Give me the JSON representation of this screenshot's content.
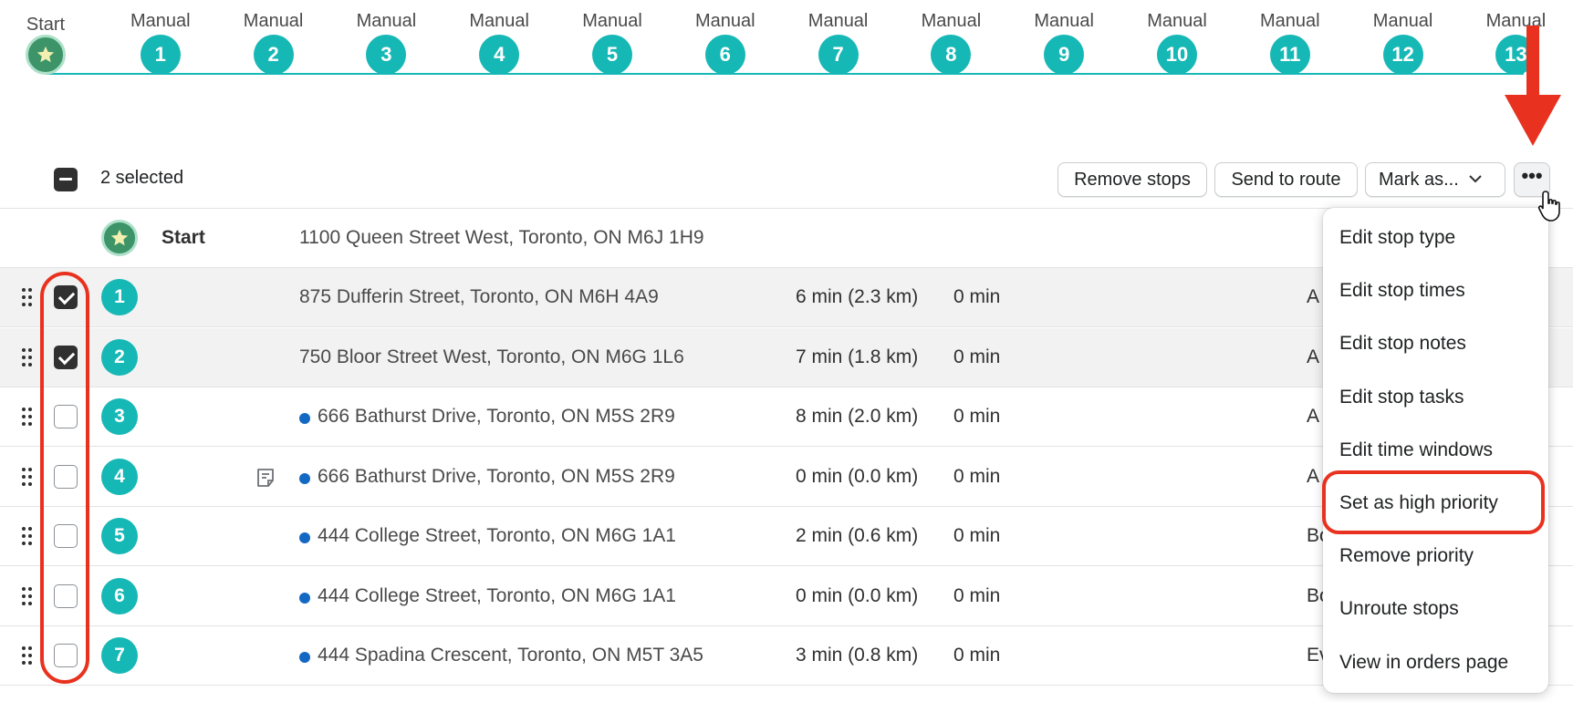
{
  "timeline": {
    "steps": [
      {
        "label": "Start",
        "badge": ""
      },
      {
        "label": "Manual",
        "badge": "1"
      },
      {
        "label": "Manual",
        "badge": "2"
      },
      {
        "label": "Manual",
        "badge": "3"
      },
      {
        "label": "Manual",
        "badge": "4"
      },
      {
        "label": "Manual",
        "badge": "5"
      },
      {
        "label": "Manual",
        "badge": "6"
      },
      {
        "label": "Manual",
        "badge": "7"
      },
      {
        "label": "Manual",
        "badge": "8"
      },
      {
        "label": "Manual",
        "badge": "9"
      },
      {
        "label": "Manual",
        "badge": "10"
      },
      {
        "label": "Manual",
        "badge": "11"
      },
      {
        "label": "Manual",
        "badge": "12"
      },
      {
        "label": "Manual",
        "badge": "13"
      }
    ]
  },
  "toolbar": {
    "selected_text": "2 selected",
    "remove_stops": "Remove stops",
    "send_to_route": "Send to route",
    "mark_as": "Mark as...",
    "more": "•••"
  },
  "start_row": {
    "label": "Start",
    "address": "1100 Queen Street West, Toronto, ON M6J 1H9"
  },
  "rows": [
    {
      "num": "1",
      "checked": true,
      "dot": false,
      "note": false,
      "address": "875 Dufferin Street, Toronto, ON M6H 4A9",
      "distance": "6 min (2.3 km)",
      "service": "0 min",
      "extra": "A"
    },
    {
      "num": "2",
      "checked": true,
      "dot": false,
      "note": false,
      "address": "750 Bloor Street West, Toronto, ON M6G 1L6",
      "distance": "7 min (1.8 km)",
      "service": "0 min",
      "extra": "A"
    },
    {
      "num": "3",
      "checked": false,
      "dot": true,
      "note": false,
      "address": "666 Bathurst Drive, Toronto, ON M5S 2R9",
      "distance": "8 min (2.0 km)",
      "service": "0 min",
      "extra": "A"
    },
    {
      "num": "4",
      "checked": false,
      "dot": true,
      "note": true,
      "address": "666 Bathurst Drive, Toronto, ON M5S 2R9",
      "distance": "0 min (0.0 km)",
      "service": "0 min",
      "extra": "A"
    },
    {
      "num": "5",
      "checked": false,
      "dot": true,
      "note": false,
      "address": "444 College Street, Toronto, ON M6G 1A1",
      "distance": "2 min (0.6 km)",
      "service": "0 min",
      "extra": "Bo"
    },
    {
      "num": "6",
      "checked": false,
      "dot": true,
      "note": false,
      "address": "444 College Street, Toronto, ON M6G 1A1",
      "distance": "0 min (0.0 km)",
      "service": "0 min",
      "extra": "Bo"
    },
    {
      "num": "7",
      "checked": false,
      "dot": true,
      "note": false,
      "address": "444 Spadina Crescent, Toronto, ON M5T 3A5",
      "distance": "3 min (0.8 km)",
      "service": "0 min",
      "extra": "Ev"
    }
  ],
  "menu": {
    "items": [
      "Edit stop type",
      "Edit stop times",
      "Edit stop notes",
      "Edit stop tasks",
      "Edit time windows",
      "Set as high priority",
      "Remove priority",
      "Unroute stops",
      "View in orders page"
    ]
  },
  "colors": {
    "teal": "#16b8b6",
    "start_green": "#3c9468",
    "annotation_red": "#e8321f",
    "dot_blue": "#1368c4"
  }
}
